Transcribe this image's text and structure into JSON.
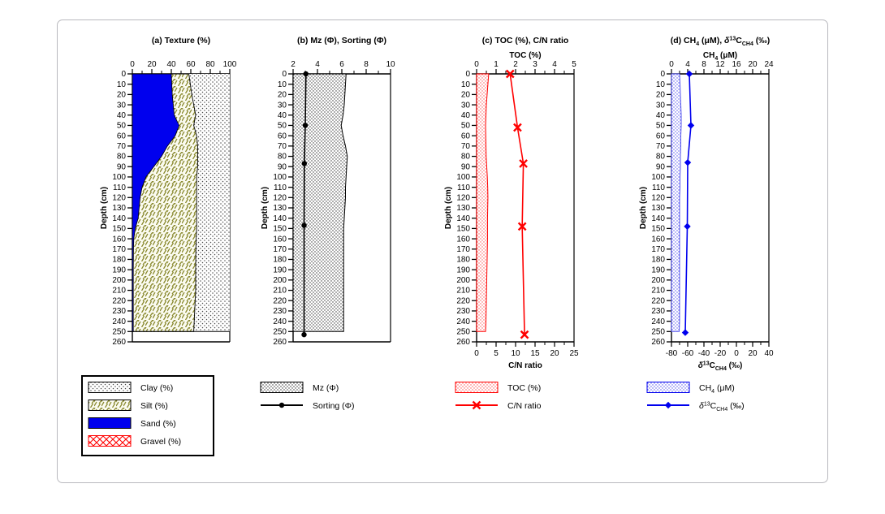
{
  "figure": {
    "depth_axis_label": "Depth (cm)",
    "depth_ticks": [
      0,
      10,
      20,
      30,
      40,
      50,
      60,
      70,
      80,
      90,
      100,
      110,
      120,
      130,
      140,
      150,
      160,
      170,
      180,
      190,
      200,
      210,
      220,
      230,
      240,
      250,
      260
    ],
    "depth_range": [
      0,
      260
    ]
  },
  "chart_data": [
    {
      "type": "area",
      "panel": "a",
      "title": "(a) Texture (%)",
      "xlabel": "",
      "ylabel": "Depth (cm)",
      "top_axis_ticks": [
        0,
        20,
        40,
        60,
        80,
        100
      ],
      "xlim": [
        0,
        100
      ],
      "ylim": [
        0,
        260
      ],
      "grid": false,
      "legend_position": "below",
      "depths": [
        0,
        10,
        20,
        30,
        40,
        50,
        60,
        70,
        80,
        90,
        100,
        110,
        120,
        130,
        140,
        150,
        160,
        170,
        180,
        190,
        200,
        210,
        220,
        230,
        240,
        250
      ],
      "series": [
        {
          "name": "Sand (%)",
          "color": "#0000ee",
          "pattern": "solid",
          "values": [
            40,
            40.5,
            41,
            42,
            43,
            48,
            44,
            36,
            30,
            22,
            14,
            10,
            8,
            7,
            6,
            3,
            1.5,
            1.2,
            1.1,
            1,
            1,
            1,
            1,
            1,
            1,
            1
          ]
        },
        {
          "name": "Silt (%)",
          "color": "#8a8a30",
          "pattern": "silt-hatch",
          "values": [
            18,
            19,
            20,
            21,
            22,
            15,
            22,
            31,
            37,
            45,
            52,
            56,
            58,
            59,
            60,
            63,
            64,
            64,
            64,
            64,
            64,
            64,
            63.5,
            63,
            62.5,
            62
          ]
        },
        {
          "name": "Clay (%)",
          "color": "#555555",
          "pattern": "clay-dots",
          "values": [
            42,
            40.5,
            39,
            37,
            35,
            37,
            34,
            33,
            33,
            33,
            34,
            34,
            34,
            34,
            34,
            34,
            34.5,
            34.8,
            34.9,
            35,
            35,
            35,
            35.5,
            36,
            36.5,
            37
          ]
        },
        {
          "name": "Gravel (%)",
          "color": "#ee0000",
          "pattern": "gravel-cross",
          "values": [
            0,
            0,
            0,
            0,
            0,
            0,
            0,
            0,
            0,
            0,
            0,
            0,
            0,
            0,
            0,
            0,
            0,
            0,
            0,
            0,
            0,
            0,
            0,
            0,
            0,
            0
          ]
        }
      ]
    },
    {
      "type": "area",
      "panel": "b",
      "title": "(b) Mz (Φ), Sorting (Φ)",
      "top_axis_ticks": [
        2,
        4,
        6,
        8,
        10
      ],
      "xlim": [
        2,
        10
      ],
      "ylim": [
        0,
        260
      ],
      "ylabel": "Depth (cm)",
      "grid": false,
      "legend_position": "below",
      "series": [
        {
          "name": "Mz (Φ)",
          "kind": "area",
          "color": "#000000",
          "pattern": "mz-dots",
          "depths": [
            0,
            10,
            20,
            30,
            40,
            50,
            60,
            70,
            80,
            90,
            100,
            110,
            120,
            130,
            140,
            150,
            160,
            170,
            180,
            190,
            200,
            210,
            220,
            230,
            240,
            250
          ],
          "values": [
            6.35,
            6.3,
            6.25,
            6.2,
            6.1,
            5.95,
            6.1,
            6.3,
            6.45,
            6.4,
            6.35,
            6.3,
            6.3,
            6.25,
            6.2,
            6.15,
            6.15,
            6.15,
            6.15,
            6.15,
            6.15,
            6.15,
            6.15,
            6.15,
            6.15,
            6.15
          ]
        },
        {
          "name": "Sorting (Φ)",
          "kind": "line",
          "color": "#000000",
          "marker": "circle",
          "depths": [
            0,
            50,
            87,
            147,
            253
          ],
          "values": [
            3.05,
            3.0,
            2.92,
            2.9,
            2.9
          ]
        }
      ]
    },
    {
      "type": "area",
      "panel": "c",
      "title": "(c) TOC (%), C/N ratio",
      "top_axis_title": "TOC (%)",
      "bottom_axis_title": "C/N ratio",
      "top_axis_ticks": [
        0,
        1,
        2,
        3,
        4,
        5
      ],
      "bottom_axis_ticks": [
        0,
        5,
        10,
        15,
        20,
        25
      ],
      "top_xlim": [
        0,
        5
      ],
      "bottom_xlim": [
        0,
        25
      ],
      "ylim": [
        0,
        260
      ],
      "ylabel": "Depth (cm)",
      "grid": false,
      "legend_position": "below",
      "series": [
        {
          "name": "TOC (%)",
          "kind": "area",
          "color": "#ff0000",
          "pattern": "toc-dots",
          "depths": [
            0,
            10,
            20,
            30,
            40,
            50,
            60,
            70,
            80,
            90,
            100,
            110,
            120,
            130,
            140,
            150,
            160,
            170,
            180,
            190,
            200,
            210,
            220,
            230,
            240,
            250
          ],
          "values": [
            0.62,
            0.58,
            0.54,
            0.5,
            0.48,
            0.46,
            0.47,
            0.48,
            0.49,
            0.52,
            0.55,
            0.57,
            0.58,
            0.57,
            0.56,
            0.56,
            0.56,
            0.55,
            0.54,
            0.53,
            0.52,
            0.51,
            0.5,
            0.49,
            0.48,
            0.46
          ]
        },
        {
          "name": "C/N ratio",
          "kind": "line",
          "color": "#ff0000",
          "marker": "cross",
          "depths": [
            0,
            52,
            87,
            148,
            253
          ],
          "values": [
            8.6,
            10.5,
            12.0,
            11.7,
            12.3
          ]
        }
      ]
    },
    {
      "type": "area",
      "panel": "d",
      "title": "(d) CH₄ (μM), δ¹³C_CH4 (‰)",
      "top_axis_title": "CH₄ (μM)",
      "bottom_axis_title": "δ¹³C_CH4 (‰)",
      "top_axis_ticks": [
        0,
        4,
        8,
        12,
        16,
        20,
        24
      ],
      "bottom_axis_ticks": [
        -80,
        -60,
        -40,
        -20,
        0,
        20,
        40
      ],
      "top_xlim": [
        0,
        24
      ],
      "bottom_xlim": [
        -80,
        40
      ],
      "ylim": [
        0,
        260
      ],
      "ylabel": "Depth (cm)",
      "grid": false,
      "legend_position": "below",
      "series": [
        {
          "name": "CH₄ (μM)",
          "kind": "area",
          "color": "#0000ee",
          "pattern": "ch4-dots",
          "depths": [
            0,
            10,
            20,
            30,
            40,
            50,
            60,
            70,
            80,
            90,
            100,
            110,
            120,
            130,
            140,
            150,
            160,
            170,
            180,
            190,
            200,
            210,
            220,
            230,
            240,
            250
          ],
          "values": [
            2.0,
            2.1,
            2.2,
            2.3,
            2.4,
            2.4,
            2.3,
            2.3,
            2.2,
            2.2,
            2.1,
            2.1,
            2.0,
            2.0,
            2.0,
            2.0,
            2.0,
            2.0,
            2.0,
            2.0,
            2.0,
            2.0,
            2.0,
            2.0,
            2.0,
            1.9
          ]
        },
        {
          "name": "δ¹³C_CH4 (‰)",
          "kind": "line",
          "color": "#0000ee",
          "marker": "diamond",
          "depths": [
            0,
            50,
            86,
            148,
            251
          ],
          "values": [
            -58,
            -56,
            -60,
            -60.5,
            -63
          ]
        }
      ]
    }
  ],
  "legends": [
    {
      "panel": "a",
      "items": [
        {
          "label": "Clay (%)",
          "swatch": "clay-dots"
        },
        {
          "label": "Silt (%)",
          "swatch": "silt-hatch"
        },
        {
          "label": "Sand (%)",
          "swatch": "sand-solid"
        },
        {
          "label": "Gravel (%)",
          "swatch": "gravel-cross"
        }
      ]
    },
    {
      "panel": "b",
      "items": [
        {
          "label": "Mz (Φ)",
          "swatch": "mz-dots"
        },
        {
          "label": "Sorting (Φ)",
          "swatch": "line-circle"
        }
      ]
    },
    {
      "panel": "c",
      "items": [
        {
          "label": "TOC (%)",
          "swatch": "toc-dots"
        },
        {
          "label": "C/N ratio",
          "swatch": "line-cross"
        }
      ]
    },
    {
      "panel": "d",
      "items": [
        {
          "label": "CH₄ (μM)",
          "swatch": "ch4-dots"
        },
        {
          "label": "δ¹³C_CH4 (‰)",
          "swatch": "line-diamond"
        }
      ]
    }
  ],
  "colors": {
    "sand": "#0000ee",
    "silt": "#8a8a30",
    "clay": "#555555",
    "gravel": "#ee0000",
    "toc": "#ff0000",
    "ch4": "#0000ee",
    "axis": "#000000",
    "frame": "#b9b9be"
  }
}
